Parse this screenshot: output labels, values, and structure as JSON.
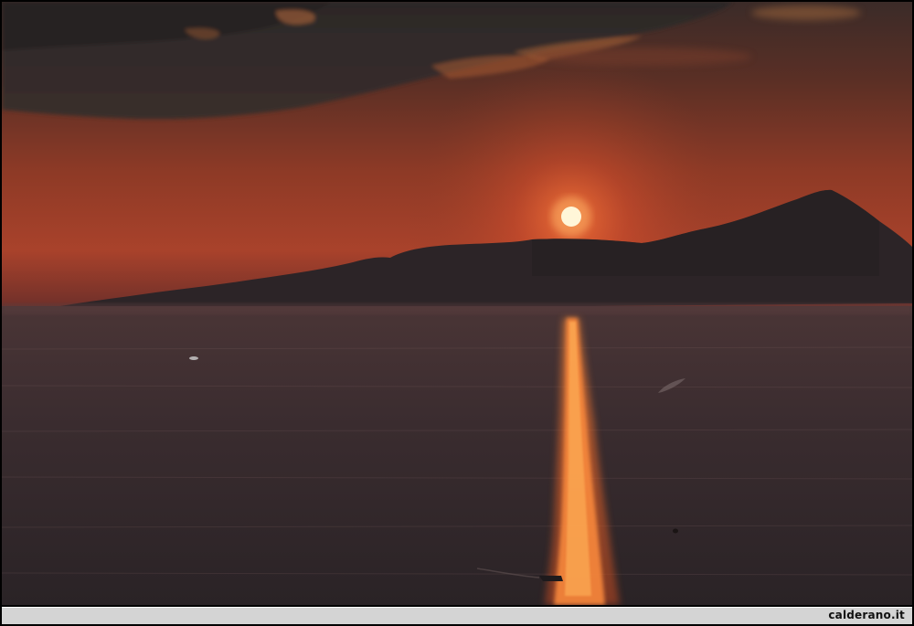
{
  "image": {
    "subject": "sunset-over-sea",
    "watermark": "calderano.it"
  },
  "colors": {
    "sky_top": "#3a2a26",
    "sky_mid": "#8a3a26",
    "sky_glow": "#c2462a",
    "sea": "#3a2b2c",
    "mountain": "#2c2426",
    "sun": "#fff6d8",
    "reflection": "#ff7a2a",
    "caption_bar": "#d4d4d4"
  }
}
